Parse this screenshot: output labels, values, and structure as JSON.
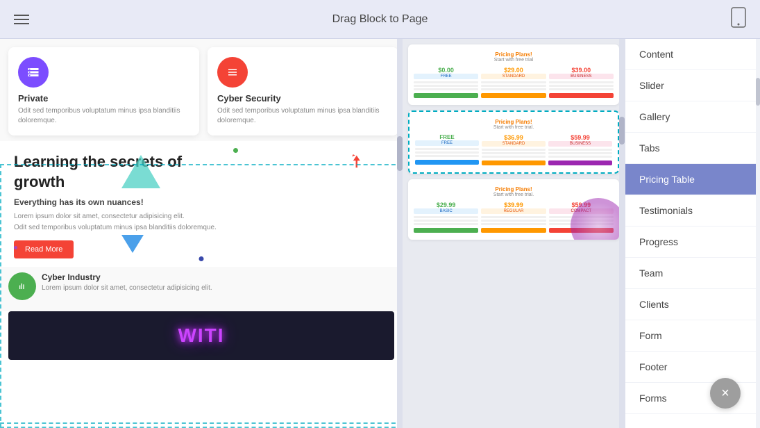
{
  "topBar": {
    "title": "Drag Block to Page",
    "hamburger_label": "menu",
    "device_icon": "📱"
  },
  "sidebar": {
    "items": [
      {
        "id": "content",
        "label": "Content"
      },
      {
        "id": "slider",
        "label": "Slider"
      },
      {
        "id": "gallery",
        "label": "Gallery"
      },
      {
        "id": "tabs",
        "label": "Tabs"
      },
      {
        "id": "pricing-table",
        "label": "Pricing Table",
        "active": true
      },
      {
        "id": "testimonials",
        "label": "Testimonials"
      },
      {
        "id": "progress",
        "label": "Progress"
      },
      {
        "id": "team",
        "label": "Team"
      },
      {
        "id": "clients",
        "label": "Clients"
      },
      {
        "id": "form",
        "label": "Form"
      },
      {
        "id": "footer",
        "label": "Footer"
      },
      {
        "id": "forms",
        "label": "Forms"
      }
    ]
  },
  "canvas": {
    "cards": [
      {
        "icon": "layers",
        "icon_color": "purple",
        "title": "Private",
        "text": "Odit sed temporibus voluptatum minus ipsa blanditiis doloremque."
      },
      {
        "icon": "grid",
        "icon_color": "red",
        "title": "Cyber Security",
        "text": "Odit sed temporibus voluptatum minus ipsa blanditiis doloremque."
      },
      {
        "icon": "equalizer",
        "icon_color": "green",
        "title": "Cyber Industry",
        "text": "Lorem ipsum dolor sit amet, consectetur adipisicing elit."
      }
    ],
    "hero": {
      "title": "Learning the secrets of growth",
      "subtitle": "Everything has its own nuances!",
      "body": "Lorem ipsum dolor sit amet, consectetur adipisicing elit.\nOdit sed temporibus voluptatum minus ipsa blanditiis doloremque.",
      "button_label": "Read More"
    },
    "pricingBlocks": [
      {
        "title": "Pricing Plans!",
        "subtitle": "Start with free trial",
        "cols": [
          {
            "price": "$0.00",
            "badge": "FREE",
            "price_color": "green"
          },
          {
            "price": "$29.00",
            "badge": "STANDARD",
            "price_color": "orange"
          },
          {
            "price": "$39.00",
            "badge": "BUSINESS",
            "price_color": "red"
          }
        ]
      },
      {
        "title": "Pricing Plans!",
        "subtitle": "Start with free trial.",
        "cols": [
          {
            "price": "FREE",
            "badge": "FREE",
            "price_color": "green"
          },
          {
            "price": "$36.99",
            "badge": "STANDARD",
            "price_color": "orange"
          },
          {
            "price": "$59.99",
            "badge": "BUSINESS",
            "price_color": "red"
          }
        ]
      },
      {
        "title": "Pricing Plans!",
        "subtitle": "Start with free trial.",
        "cols": [
          {
            "price": "$29.99",
            "badge": "BASIC",
            "price_color": "green"
          },
          {
            "price": "$39.99",
            "badge": "REGULAR",
            "price_color": "orange"
          },
          {
            "price": "$59.99",
            "badge": "COMPACT",
            "price_color": "red"
          }
        ]
      }
    ]
  },
  "closeButton": {
    "label": "×"
  }
}
